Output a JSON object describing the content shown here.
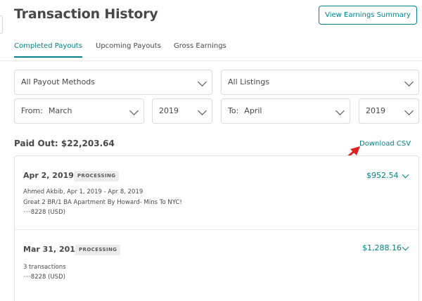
{
  "header": {
    "title": "Transaction History",
    "summary_button": "View Earnings Summary"
  },
  "tabs": [
    {
      "label": "Completed Payouts",
      "active": true
    },
    {
      "label": "Upcoming Payouts",
      "active": false
    },
    {
      "label": "Gross Earnings",
      "active": false
    }
  ],
  "filters": {
    "payout_method": "All Payout Methods",
    "listing": "All Listings",
    "from_label": "From:",
    "from_month": "March",
    "from_year": "2019",
    "to_label": "To:",
    "to_month": "April",
    "to_year": "2019"
  },
  "summary": {
    "paid_out": "Paid Out: $22,203.64",
    "download_link": "Download CSV"
  },
  "transactions": [
    {
      "date": "Apr 2, 2019",
      "status": "PROCESSING",
      "amount": "$952.54",
      "guest_line": "Ahmed Akbib, Apr 1, 2019 - Apr 8, 2019",
      "listing_line": "Great 2 BR/1 BA Apartment By Howard- Mins To NYC!",
      "account_line": "····8228 (USD)"
    },
    {
      "date": "Mar 31, 2019",
      "status": "PROCESSING",
      "amount": "$1,288.16",
      "count_line": "3 transactions",
      "account_line": "····8228 (USD)"
    }
  ],
  "colors": {
    "accent": "#008489",
    "text": "#484848",
    "annotation_arrow": "#e02020"
  },
  "icons": {
    "dropdown": "chevron-down-icon",
    "annotation": "red-arrow-annotation"
  }
}
